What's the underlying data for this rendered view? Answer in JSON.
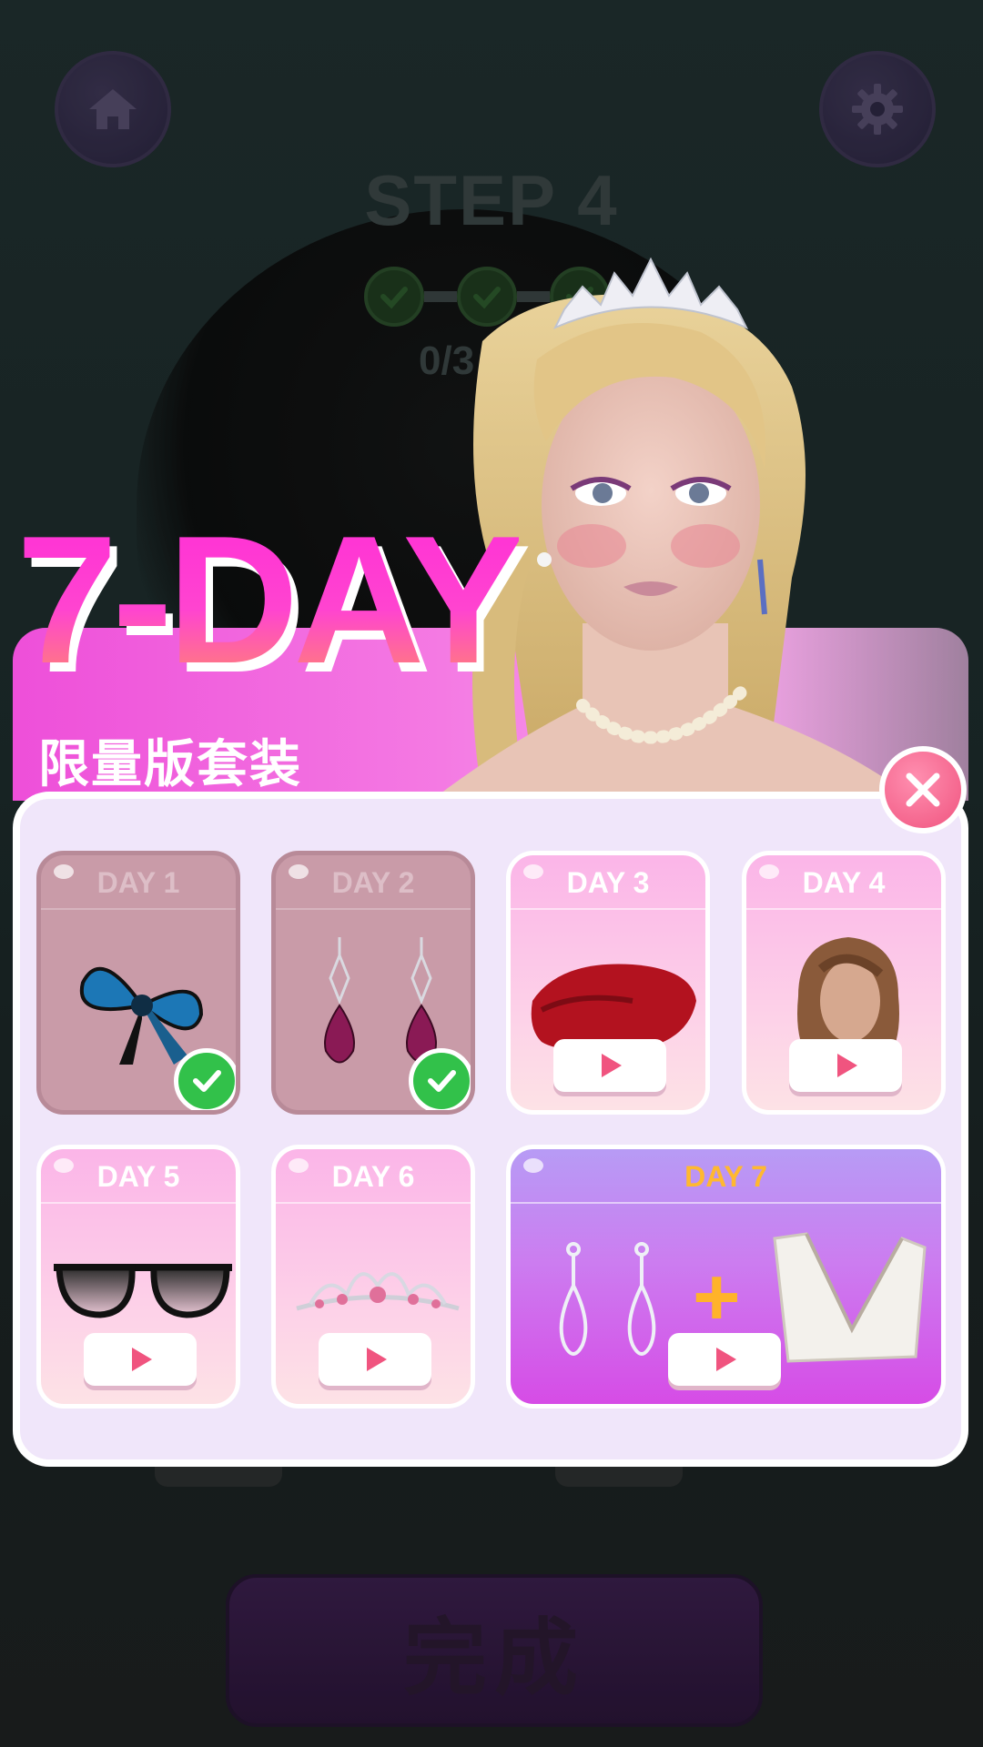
{
  "header": {
    "home_icon": "home-icon",
    "settings_icon": "gear-icon",
    "step_title": "STEP 4",
    "progress_count": "0/3"
  },
  "popup": {
    "title": "7-DAY",
    "subtitle": "限量版套装",
    "close_icon": "close-icon",
    "days": [
      {
        "label": "DAY 1",
        "item": "blue bow",
        "status": "claimed"
      },
      {
        "label": "DAY 2",
        "item": "ruby drop earrings",
        "status": "claimed"
      },
      {
        "label": "DAY 3",
        "item": "red beret",
        "status": "watch-ad"
      },
      {
        "label": "DAY 4",
        "item": "wavy brown hairstyle",
        "status": "watch-ad"
      },
      {
        "label": "DAY 5",
        "item": "black glasses",
        "status": "watch-ad"
      },
      {
        "label": "DAY 6",
        "item": "pink tiara",
        "status": "watch-ad"
      },
      {
        "label": "DAY 7",
        "item": "diamond earrings + white dress",
        "status": "watch-ad"
      }
    ],
    "plus_sign": "+"
  },
  "footer": {
    "finish_label": "完成"
  },
  "colors": {
    "accent_pink": "#ff3fd4",
    "day7_label": "#ffb830",
    "check_green": "#32c14a",
    "play_red": "#f0547f"
  }
}
